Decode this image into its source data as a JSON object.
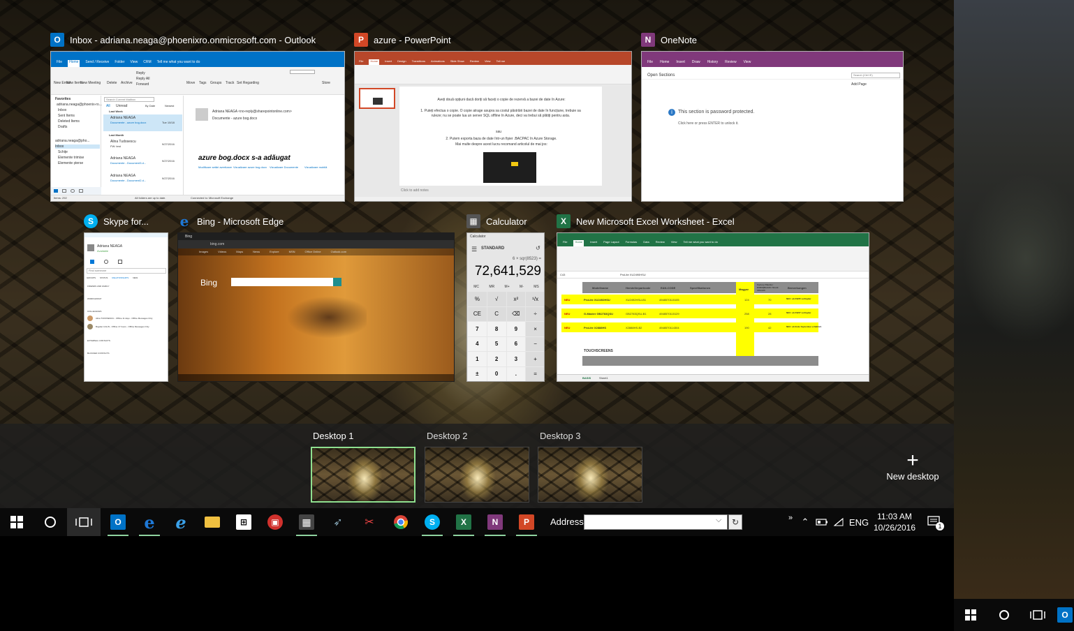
{
  "windows": {
    "outlook": {
      "title": "Inbox - adriana.neaga@phoenixro.onmicrosoft.com - Outlook",
      "icon": "outlook-icon",
      "color": "#0072c6",
      "tabs": [
        "File",
        "Home",
        "Send / Receive",
        "Folder",
        "View",
        "CRM"
      ],
      "tell_me": "Tell me what you want to do",
      "ribbon": [
        "New Email",
        "New Items",
        "New Meeting",
        "Delete",
        "Archive",
        "Reply",
        "Reply All",
        "Forward",
        "Move",
        "Tags",
        "Groups",
        "Track",
        "Set Regarding",
        "Store"
      ],
      "folders": [
        "Favorites",
        "adriana.neaga@phoenix-ro...",
        "Inbox",
        "Sent Items",
        "Deleted Items",
        "Drafts",
        "adriana.neaga@pho...",
        "Inbox",
        "Schițe",
        "Elemente trimise",
        "Elemente șterse"
      ],
      "search": "Search Current Mailbox",
      "filters": [
        "All",
        "Unread",
        "By Date",
        "Newest"
      ],
      "groups": [
        "Last Week",
        "Last Month"
      ],
      "messages": [
        {
          "from": "Adriana NEAGA",
          "subject": "Documente - azure bog.docx",
          "date": "Tue 10/18"
        },
        {
          "from": "Alina Tudosescu",
          "subject": "FW: test",
          "date": "9/27/2016"
        },
        {
          "from": "Adriana NEAGA",
          "subject": "Documente - Document3.d...",
          "date": "9/27/2016"
        },
        {
          "from": "Adriana NEAGA",
          "subject": "Documente - Document2.d...",
          "date": "9/27/2016"
        }
      ],
      "reading": {
        "sender": "Adriana NEAGA <no-reply@sharepointonline.com>",
        "subject": "Documente - azure bog.docx",
        "headline": "azure bog.docx s-a adăugat",
        "links": [
          "Modificare setări avertizare",
          "Vizualizare azure bog.docx",
          "Vizualizare Documente",
          "Vizualizare mobilă"
        ]
      },
      "status": [
        "Items: 292",
        "All folders are up to date.",
        "Connected to: Microsoft Exchange"
      ]
    },
    "powerpoint": {
      "title": "azure - PowerPoint",
      "icon": "powerpoint-icon",
      "color": "#d24726",
      "tabs": [
        "File",
        "Home",
        "Insert",
        "Design",
        "Transitions",
        "Animations",
        "Slide Show",
        "Review",
        "View",
        "Tell me"
      ],
      "slide_lines": [
        "Aveți două opțiuni dacă doriți să faceți o copie de rezervă a bazei de date în Azure:",
        "1. Puteți efectua o copie. O copie atrage asupra sa costul păstrării bazei de date în funcțiune, trebuie sa ruleze; nu se poate lua un server SQL offline în Azure, deci va trebui să plătiți pentru asta.",
        "sau",
        "2. Putem exporta baza de date într-un fișier .BACPAC în Azure Storage.",
        "Mai multe despre acest lucru recomand articolul de mai jos:"
      ],
      "notes": "Click to add notes"
    },
    "onenote": {
      "title": "OneNote",
      "icon": "onenote-icon",
      "color": "#80397b",
      "tabs": [
        "File",
        "Home",
        "Insert",
        "Draw",
        "History",
        "Review",
        "View"
      ],
      "sections": "Open Sections",
      "search": "Search (Ctrl+E)",
      "add_page": "Add Page",
      "protected": "This section is password protected.",
      "unlock": "Click here or press ENTER to unlock it."
    },
    "skype": {
      "title": "Skype for...",
      "icon": "skype-icon",
      "color": "#00aff0",
      "user": "Adriana NEAGA",
      "status": "Available",
      "find": "Find someone",
      "tabs": [
        "GROUPS",
        "STATUS",
        "RELATIONSHIPS",
        "NEW"
      ],
      "groups": [
        "FRIENDS AND FAMILY",
        "WORKGROUP",
        "COLLEAGUES",
        "EXTERNAL CONTACTS",
        "BLOCKED CONTACTS"
      ],
      "contacts": [
        "Alina TUDOSESCU - Offline 11 days - Offline Messages Only",
        "Bogdan CALIN - Offline 17 hours - Offline Messages Only"
      ]
    },
    "edge": {
      "title": "Bing - Microsoft Edge",
      "icon": "edge-icon",
      "color": "#1e78d6",
      "tab": "Bing",
      "url": "bing.com",
      "nav": [
        "Images",
        "Videos",
        "Maps",
        "News",
        "Explore",
        "MSN",
        "Office Online",
        "Outlook.com"
      ],
      "logo": "Bing"
    },
    "calculator": {
      "title": "Calculator",
      "icon": "calculator-icon",
      "app": "Calculator",
      "mode": "STANDARD",
      "expression": "6 × sqr(8523) =",
      "display": "72,641,529",
      "memory": [
        "MC",
        "MR",
        "M+",
        "M-",
        "MS"
      ],
      "keys": [
        "%",
        "√",
        "x²",
        "¹/x",
        "CE",
        "C",
        "⌫",
        "÷",
        "7",
        "8",
        "9",
        "×",
        "4",
        "5",
        "6",
        "−",
        "1",
        "2",
        "3",
        "+",
        "±",
        "0",
        ".",
        "="
      ]
    },
    "excel": {
      "title": "New Microsoft Excel Worksheet - Excel",
      "icon": "excel-icon",
      "color": "#217346",
      "tabs": [
        "File",
        "Home",
        "Insert",
        "Page Layout",
        "Formulas",
        "Data",
        "Review",
        "View",
        "Tell me what you want to do"
      ],
      "cell_ref": "C43",
      "formula": "ProLite XU2490HSU",
      "headers": [
        "Modellname",
        "Herstellerpartcode",
        "EAN-CODE",
        "Spezifikationen",
        "Magyar",
        "Factory Palette / EURO(80x120 / Stock: 100x120",
        "Bemerkungen"
      ],
      "rows": [
        {
          "tag": "NEU",
          "model": "ProLite XU2492HSU",
          "code": "XU2492HSU-B1",
          "ean": "4948570115105",
          "qty": "124",
          "pal": "70",
          "note": "NEU: ab KW35 verfügbar"
        },
        {
          "tag": "NEU",
          "model": "G-Master GB2783QSU",
          "code": "GB2783QSU-B1",
          "ean": "4948570115129",
          "qty": "258",
          "pal": "28",
          "note": "NEU: ab KW37 verfügbar"
        },
        {
          "tag": "NEU",
          "model": "ProLite X2888HS",
          "code": "X2888HS-B2",
          "ean": "4948570114304",
          "qty": "190",
          "pal": "42",
          "note": "NEU: ab Ende September erhältlich"
        }
      ],
      "section": "TOUCHSCREENS",
      "sheet_tabs": [
        "BASIS",
        "Sheet1"
      ]
    }
  },
  "desktops": {
    "items": [
      "Desktop 1",
      "Desktop 2",
      "Desktop 3"
    ],
    "new_label": "New desktop"
  },
  "taskbar": {
    "address_label": "Address",
    "address_value": "",
    "language": "ENG",
    "time": "11:03 AM",
    "date": "10/26/2016",
    "notification_count": "1"
  }
}
